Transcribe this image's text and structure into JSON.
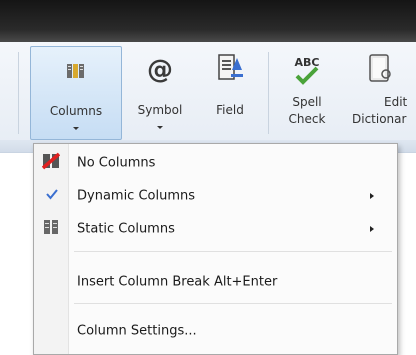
{
  "ribbon": {
    "buttons": [
      {
        "label": "Columns",
        "icon": "columns-icon"
      },
      {
        "label": "Symbol",
        "icon": "at-sign-icon"
      },
      {
        "label": "Field",
        "icon": "field-icon"
      },
      {
        "label": "Spell",
        "label2": "Check",
        "icon": "spell-check-icon",
        "icon_text": "ABC"
      },
      {
        "label": "Edit",
        "label2": "Dictionar",
        "icon": "dictionary-icon"
      }
    ]
  },
  "menu": {
    "items": [
      {
        "label": "No Columns",
        "icon": "no-columns-icon"
      },
      {
        "label": "Dynamic Columns",
        "icon": "checkmark-icon",
        "checked": true,
        "has_submenu": true
      },
      {
        "label": "Static Columns",
        "icon": "static-columns-icon",
        "has_submenu": true
      },
      {
        "label": "Insert Column Break Alt+Enter"
      },
      {
        "label": "Column Settings..."
      }
    ]
  },
  "colors": {
    "accent": "#3a6fd0",
    "menu_border": "#a9a9a9",
    "ribbon_active": "#c6ddf4"
  }
}
